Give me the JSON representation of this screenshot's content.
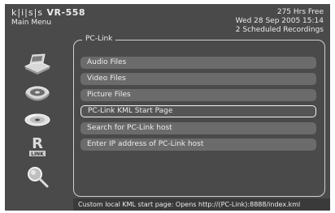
{
  "header": {
    "brand": "k|i|s|s",
    "model": "VR-558",
    "menu_title": "Main Menu",
    "hours_free": "275 Hrs Free",
    "datetime": "Wed 28 Sep 2005 15:14",
    "scheduled": "2 Scheduled Recordings"
  },
  "sidebar": {
    "icons": [
      "tv-icon",
      "dvd-player-icon",
      "disc-icon",
      "pc-link-icon",
      "search-magnifier-icon"
    ],
    "pc_link_icon_text": "LINK"
  },
  "panel": {
    "title": "PC-Link",
    "items": [
      {
        "label": "Audio Files"
      },
      {
        "label": "Video Files"
      },
      {
        "label": "Picture Files"
      },
      {
        "label": "PC-Link KML Start Page",
        "selected": true
      },
      {
        "label": "Search for PC-Link host"
      },
      {
        "label": "Enter IP address of PC-Link host"
      }
    ]
  },
  "status": {
    "text": "Custom local KML start page: Opens http://(PC-Link):8888/index.kml"
  },
  "colors": {
    "screen_background": "#4a4a4a",
    "item_background": "#6b6b6b",
    "text": "#ececec",
    "selection_border": "#f2f2f2"
  }
}
